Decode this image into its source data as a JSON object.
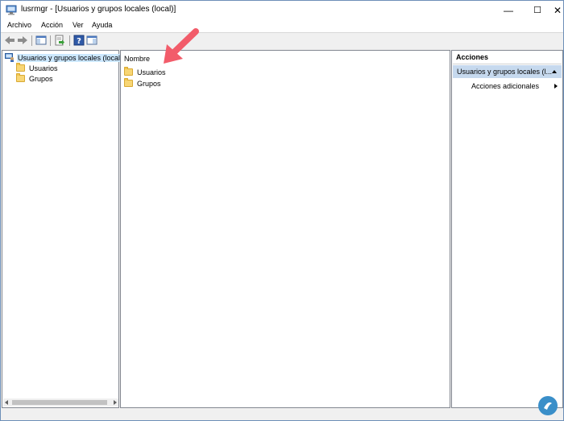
{
  "window": {
    "title": "lusrmgr - [Usuarios y grupos locales (local)]",
    "minimize_glyph": "—",
    "maximize_glyph": "☐",
    "close_glyph": "✕"
  },
  "menu": {
    "items": [
      "Archivo",
      "Acción",
      "Ver",
      "Ayuda"
    ]
  },
  "toolbar": {
    "icons": [
      "back-icon",
      "forward-icon",
      "show-hide-console-tree-icon",
      "export-list-icon",
      "help-icon",
      "show-hide-action-pane-icon"
    ]
  },
  "tree": {
    "root": "Usuarios y grupos locales (local)",
    "children": [
      "Usuarios",
      "Grupos"
    ]
  },
  "content": {
    "column_header": "Nombre",
    "items": [
      "Usuarios",
      "Grupos"
    ]
  },
  "actions": {
    "header": "Acciones",
    "section": "Usuarios y grupos locales (l...",
    "items": [
      "Acciones adicionales"
    ]
  },
  "colors": {
    "selection": "#c6d9ee",
    "annotation_arrow": "#f25c6a",
    "folder": "#f8d675"
  }
}
